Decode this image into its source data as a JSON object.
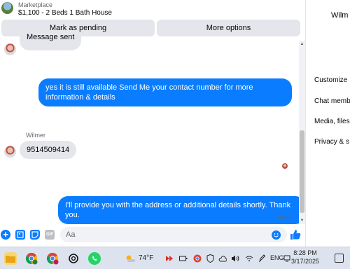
{
  "header": {
    "marketplace_label": "Marketplace",
    "listing_title": "$1,100 - 2 Beds 1 Bath House"
  },
  "actions": {
    "mark_pending": "Mark as pending",
    "more_options": "More options"
  },
  "messages": {
    "partial_incoming": "Message sent",
    "outgoing_1": "yes it is still available Send Me your contact number for more information & details",
    "sender_name": "Wilmer",
    "incoming_phone": "9514509414",
    "outgoing_2": "I'll provide you with the address or additional details shortly. Thank you.",
    "status": "Sent"
  },
  "composer": {
    "placeholder": "Aa",
    "gif_label": "GIF"
  },
  "side_panel": {
    "title": "Wilm",
    "items": [
      "Customize",
      "Chat memb",
      "Media, files",
      "Privacy & s"
    ]
  },
  "taskbar": {
    "temperature": "74°F",
    "language": "ENG",
    "time": "8:28 PM",
    "date": "3/17/2025"
  },
  "colors": {
    "accent": "#0a7cff",
    "bubble_incoming": "#e4e6eb",
    "taskbar": "#dde3ee"
  }
}
